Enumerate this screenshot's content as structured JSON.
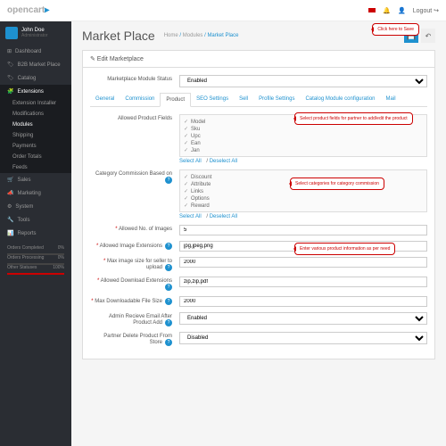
{
  "logo": {
    "t1": "opencart",
    "t2": "▸"
  },
  "topRight": {
    "logout": "Logout"
  },
  "user": {
    "name": "John Doe",
    "role": "Administrator"
  },
  "sidebar": {
    "items": [
      "Dashboard",
      "B2B Market Place",
      "Catalog",
      "Extensions",
      "Sales",
      "Marketing",
      "System",
      "Tools",
      "Reports"
    ],
    "subs": [
      "Extension Installer",
      "Modifications",
      "Modules",
      "Shipping",
      "Payments",
      "Order Totals",
      "Feeds"
    ],
    "stats": [
      {
        "l": "Orders Completed",
        "v": "0%"
      },
      {
        "l": "Orders Processing",
        "v": "0%"
      },
      {
        "l": "Other Statuses",
        "v": "100%"
      }
    ]
  },
  "page": {
    "title": "Market Place",
    "bc": [
      "Home",
      "Modules",
      "Market Place"
    ]
  },
  "panel": {
    "title": "✎ Edit Marketplace"
  },
  "form": {
    "status": {
      "label": "Marketplace Module Status",
      "value": "Enabled"
    },
    "tabs": [
      "General",
      "Commission",
      "Product",
      "SEO Settings",
      "Sell",
      "Profile Settings",
      "Catalog Module configuration",
      "Mail"
    ],
    "allowedFields": {
      "label": "Allowed Product Fields",
      "items": [
        "Model",
        "Sku",
        "Upc",
        "Ean",
        "Jan"
      ],
      "links": [
        "Select All",
        "Deselect All"
      ]
    },
    "catComm": {
      "label": "Category Commission Based on",
      "items": [
        "Discount",
        "Attribute",
        "Links",
        "Options",
        "Reward"
      ],
      "links": [
        "Select All",
        "Deselect All"
      ]
    },
    "numImages": {
      "label": "Allowed No. of Images",
      "value": "5"
    },
    "imgExt": {
      "label": "Allowed Image Extensions",
      "value": "jpg,jpeg,png"
    },
    "maxImg": {
      "label": "Max image size for seller to upload",
      "value": "2000"
    },
    "dlExt": {
      "label": "Allowed Download Extensions",
      "value": "zip,zip,pdf"
    },
    "maxDl": {
      "label": "Max Downloadable File Size",
      "value": "2000"
    },
    "adminEmail": {
      "label": "Admin Recieve Email After Product Add",
      "value": "Enabled"
    },
    "partnerDel": {
      "label": "Partner Delete Product From Store",
      "value": "Disabled"
    }
  },
  "callouts": {
    "save": "Click here to Save",
    "fields": "Select product fields for partner to add/edit the product",
    "cat": "Select categories for category commission",
    "info": "Enter various product information as per need"
  }
}
